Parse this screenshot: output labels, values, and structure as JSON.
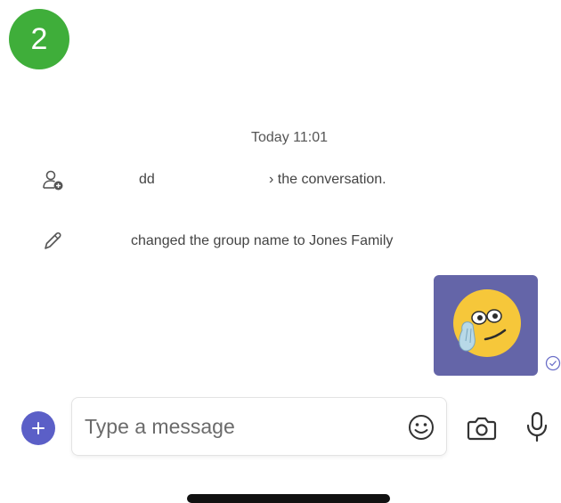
{
  "step_badge": {
    "number": "2",
    "color": "#3fae3a"
  },
  "conversation": {
    "timestamp": "Today 11:01",
    "events": [
      {
        "icon": "person-add-icon",
        "text_start": "dd",
        "text_end": "› the conversation."
      },
      {
        "icon": "pencil-icon",
        "text": "changed the group name to Jones Family"
      }
    ],
    "sticker": {
      "icon": "thinking-face-sticker",
      "background": "#6465a8"
    },
    "status_icon": "seen-check-icon"
  },
  "composer": {
    "placeholder": "Type a message",
    "value": "",
    "add_icon": "plus-icon",
    "emoji_icon": "emoji-icon",
    "camera_icon": "camera-icon",
    "mic_icon": "microphone-icon",
    "accent": "#5b5fc7"
  }
}
